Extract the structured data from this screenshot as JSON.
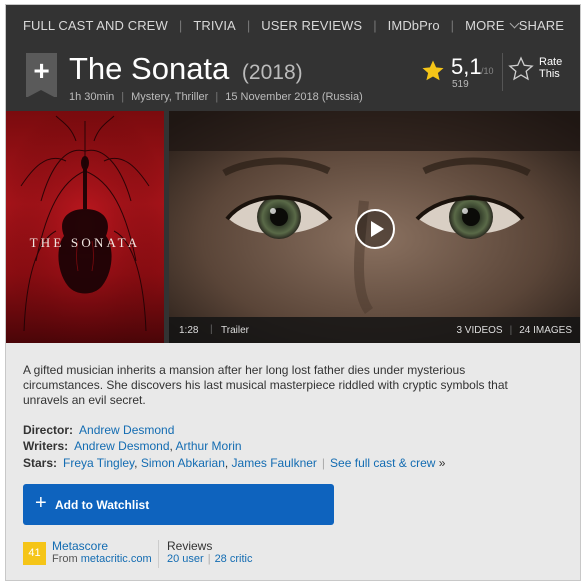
{
  "nav": {
    "items": [
      "FULL CAST AND CREW",
      "TRIVIA",
      "USER REVIEWS",
      "IMDbPro",
      "MORE"
    ],
    "share": "SHARE"
  },
  "movie": {
    "title": "The Sonata",
    "year": "(2018)",
    "runtime": "1h 30min",
    "genres": "Mystery, Thriller",
    "release": "15 November 2018 (Russia)"
  },
  "rating": {
    "value": "5,1",
    "out_of": "/10",
    "count": "519",
    "rate_label_1": "Rate",
    "rate_label_2": "This"
  },
  "poster": {
    "title": "THE SONATA"
  },
  "video": {
    "duration": "1:28",
    "label": "Trailer",
    "videos": "3 VIDEOS",
    "images": "24 IMAGES"
  },
  "plot": "A gifted musician inherits a mansion after her long lost father dies under mysterious circumstances. She discovers his last musical masterpiece riddled with cryptic symbols that unravels an evil secret.",
  "credits": {
    "director_label": "Director:",
    "director": "Andrew Desmond",
    "writers_label": "Writers:",
    "writer_1": "Andrew Desmond",
    "writer_2": "Arthur Morin",
    "stars_label": "Stars:",
    "star_1": "Freya Tingley",
    "star_2": "Simon Abkarian",
    "star_3": "James Faulkner",
    "see_full": "See full cast & crew",
    "see_full_arrow": "»"
  },
  "watchlist": {
    "label": "Add to Watchlist"
  },
  "metascore": {
    "score": "41",
    "title": "Metascore",
    "from_prefix": "From",
    "source": "metacritic.com"
  },
  "reviews": {
    "title": "Reviews",
    "user": "20 user",
    "critic": "28 critic"
  },
  "colors": {
    "accent_yellow": "#f5c518",
    "button_blue": "#0e63be",
    "link_blue": "#136cb2",
    "header_bg": "#333333"
  }
}
